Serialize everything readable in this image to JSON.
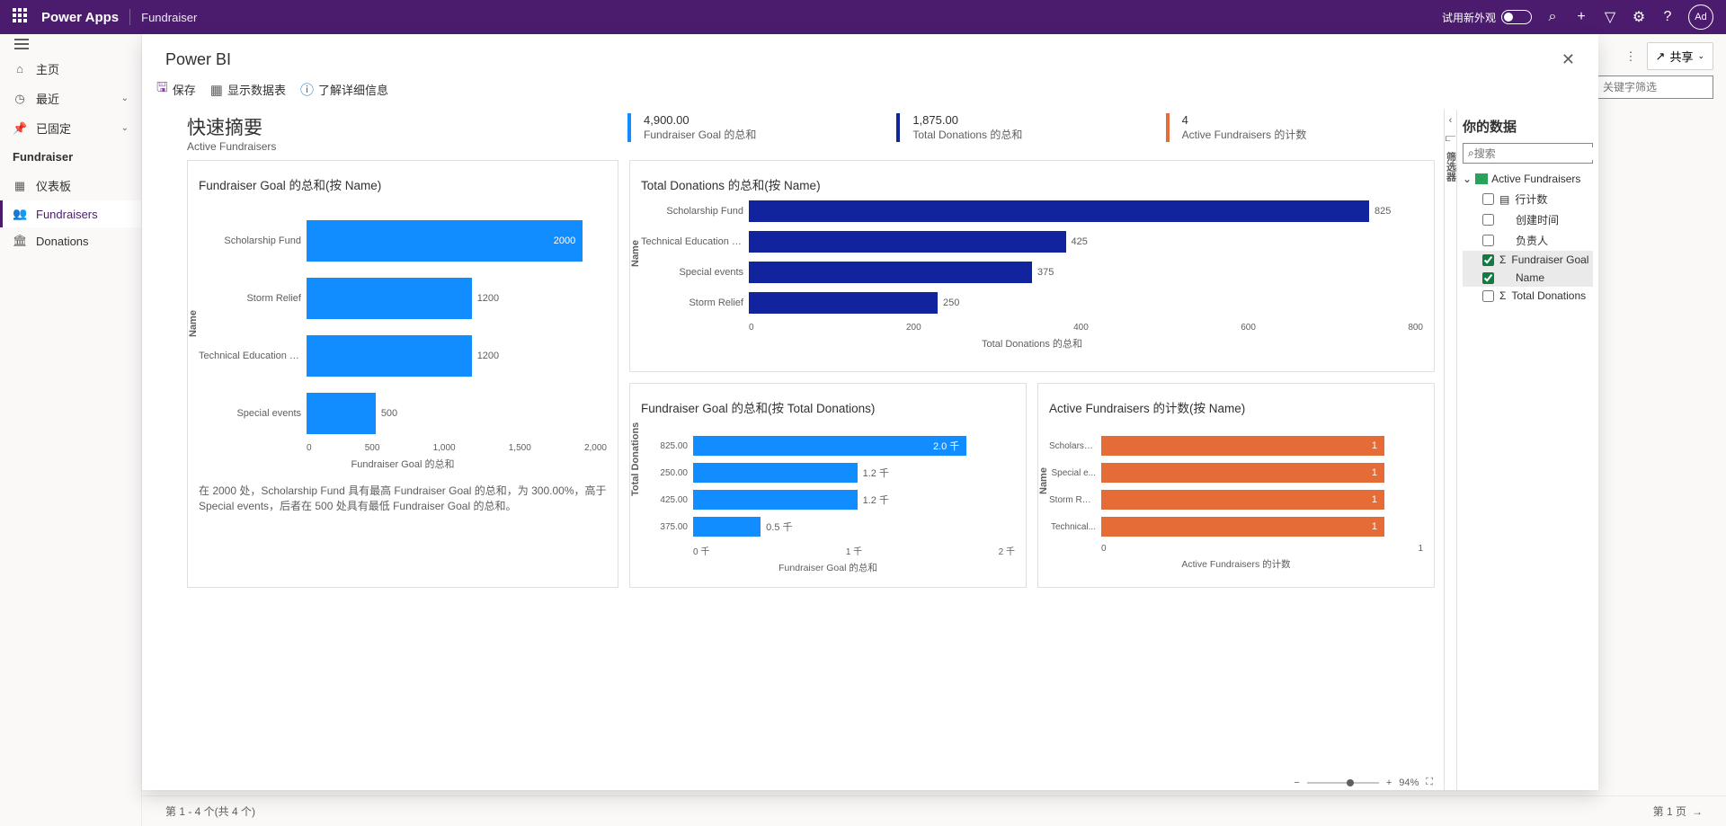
{
  "header": {
    "app": "Power Apps",
    "page": "Fundraiser",
    "try_new_look": "试用新外观",
    "avatar": "Ad"
  },
  "sidebar": {
    "home": "主页",
    "recent": "最近",
    "pinned": "已固定",
    "section": "Fundraiser",
    "items": {
      "dashboards": "仪表板",
      "fundraisers": "Fundraisers",
      "donations": "Donations"
    }
  },
  "toolbar": {
    "share": "共享",
    "search_placeholder": "关键字筛选"
  },
  "footer": {
    "count": "第 1 - 4 个(共 4 个)",
    "page": "第 1 页"
  },
  "modal": {
    "title": "Power BI",
    "save": "保存",
    "show_data": "显示数据表",
    "learn_more": "了解详细信息"
  },
  "summary": {
    "title": "快速摘要",
    "subtitle": "Active Fundraisers",
    "kpis": [
      {
        "value": "4,900.00",
        "label": "Fundraiser Goal 的总和",
        "cls": "blue"
      },
      {
        "value": "1,875.00",
        "label": "Total Donations 的总和",
        "cls": "navy"
      },
      {
        "value": "4",
        "label": "Active Fundraisers 的计数",
        "cls": "orange"
      }
    ]
  },
  "chart1": {
    "title": "Fundraiser Goal 的总和(按 Name)",
    "y_axis": "Name",
    "x_axis": "Fundraiser Goal 的总和",
    "insight": "在 2000 处，Scholarship Fund 具有最高 Fundraiser Goal 的总和，为 300.00%，高于 Special events，后者在 500 处具有最低 Fundraiser Goal 的总和。",
    "ticks": [
      "0",
      "500",
      "1,000",
      "1,500",
      "2,000"
    ]
  },
  "chart2": {
    "title": "Total Donations 的总和(按 Name)",
    "y_axis": "Name",
    "x_axis": "Total Donations 的总和",
    "ticks": [
      "0",
      "200",
      "400",
      "600",
      "800"
    ]
  },
  "chart3": {
    "title": "Fundraiser Goal 的总和(按 Total Donations)",
    "y_axis": "Total Donations",
    "x_axis": "Fundraiser Goal 的总和",
    "ticks": [
      "0 千",
      "1 千",
      "2 千"
    ]
  },
  "chart4": {
    "title": "Active Fundraisers 的计数(按 Name)",
    "y_axis": "Name",
    "x_axis": "Active Fundraisers 的计数",
    "ticks": [
      "0",
      "1"
    ]
  },
  "chart_data": [
    {
      "type": "bar",
      "orientation": "horizontal",
      "title": "Fundraiser Goal 的总和(按 Name)",
      "ylabel": "Name",
      "xlabel": "Fundraiser Goal 的总和",
      "xlim": [
        0,
        2000
      ],
      "categories": [
        "Scholarship Fund",
        "Storm Relief",
        "Technical Education for ...",
        "Special events"
      ],
      "values": [
        2000,
        1200,
        1200,
        500
      ],
      "color": "#118dff"
    },
    {
      "type": "bar",
      "orientation": "horizontal",
      "title": "Total Donations 的总和(按 Name)",
      "ylabel": "Name",
      "xlabel": "Total Donations 的总和",
      "xlim": [
        0,
        900
      ],
      "categories": [
        "Scholarship Fund",
        "Technical Education for ...",
        "Special events",
        "Storm Relief"
      ],
      "values": [
        825,
        425,
        375,
        250
      ],
      "color": "#12239e"
    },
    {
      "type": "bar",
      "orientation": "horizontal",
      "title": "Fundraiser Goal 的总和(按 Total Donations)",
      "ylabel": "Total Donations",
      "xlabel": "Fundraiser Goal 的总和",
      "xlim": [
        0,
        2000
      ],
      "categories": [
        "825.00",
        "250.00",
        "425.00",
        "375.00"
      ],
      "values": [
        2000,
        1200,
        1200,
        500
      ],
      "value_labels": [
        "2.0 千",
        "1.2 千",
        "1.2 千",
        "0.5 千"
      ],
      "color": "#118dff"
    },
    {
      "type": "bar",
      "orientation": "horizontal",
      "title": "Active Fundraisers 的计数(按 Name)",
      "ylabel": "Name",
      "xlabel": "Active Fundraisers 的计数",
      "xlim": [
        0,
        1
      ],
      "categories": [
        "Scholarsh...",
        "Special e...",
        "Storm Rel...",
        "Technical..."
      ],
      "values": [
        1,
        1,
        1,
        1
      ],
      "color": "#e66c37"
    }
  ],
  "data_pane": {
    "title": "你的数据",
    "search_placeholder": "搜索",
    "table": "Active Fundraisers",
    "fields": [
      {
        "label": "行计数",
        "sigma": false,
        "icon": "▤",
        "checked": false
      },
      {
        "label": "创建时间",
        "sigma": false,
        "checked": false
      },
      {
        "label": "负责人",
        "sigma": false,
        "checked": false
      },
      {
        "label": "Fundraiser Goal",
        "sigma": true,
        "checked": true
      },
      {
        "label": "Name",
        "sigma": false,
        "checked": true
      },
      {
        "label": "Total Donations",
        "sigma": true,
        "checked": false
      }
    ]
  },
  "filter_label": "筛选器",
  "zoom": "94%"
}
